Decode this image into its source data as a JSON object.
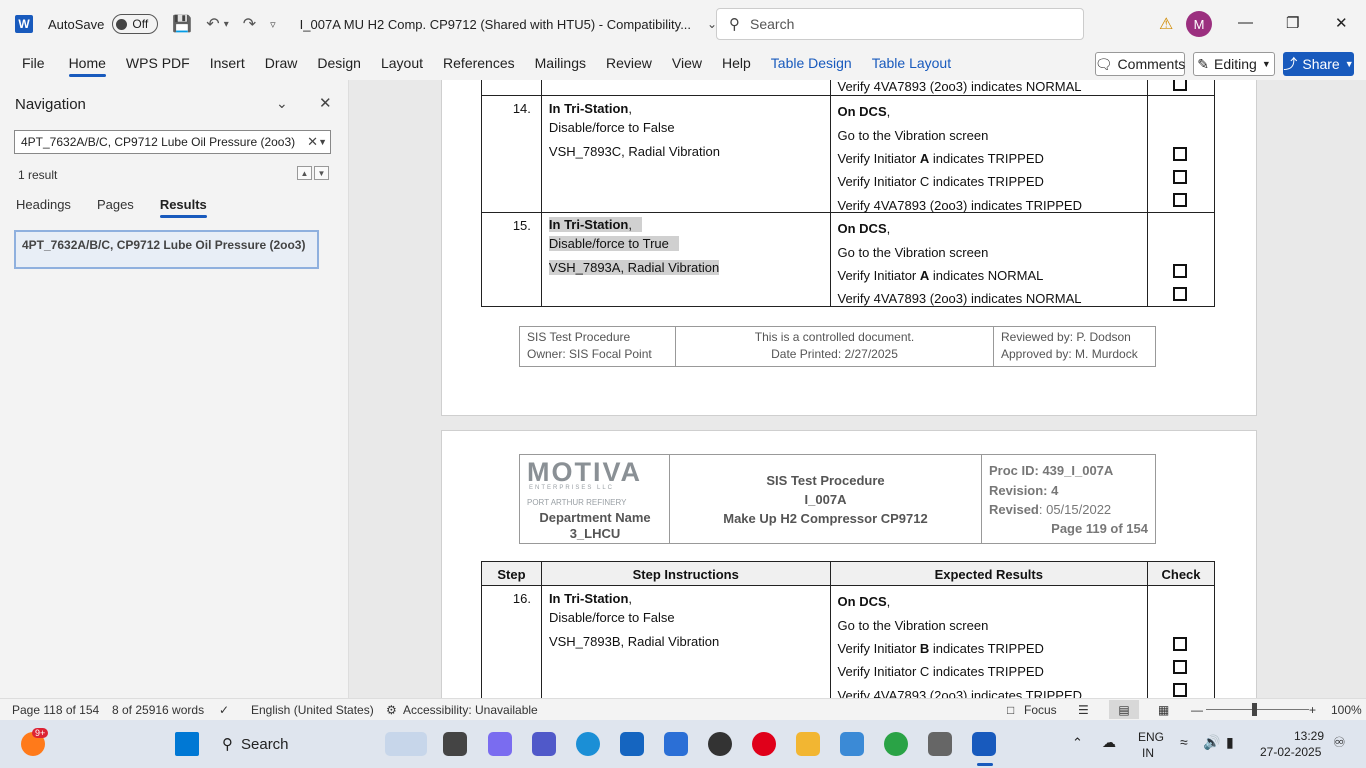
{
  "titlebar": {
    "app_icon": "W",
    "autosave_label": "AutoSave",
    "autosave_state": "Off",
    "doc_title": "I_007A MU H2 Comp. CP9712 (Shared with HTU5)  -  Compatibility...",
    "search_placeholder": "Search",
    "avatar_initial": "M"
  },
  "ribbon": {
    "tabs": [
      "File",
      "Home",
      "WPS PDF",
      "Insert",
      "Draw",
      "Design",
      "Layout",
      "References",
      "Mailings",
      "Review",
      "View",
      "Help",
      "Table Design",
      "Table Layout"
    ],
    "active_tab": "Home",
    "comments_label": "Comments",
    "editing_label": "Editing",
    "share_label": "Share"
  },
  "navigation": {
    "title": "Navigation",
    "search_value": "4PT_7632A/B/C, CP9712 Lube Oil Pressure (2oo3)",
    "result_count": "1 result",
    "tabs": [
      "Headings",
      "Pages",
      "Results"
    ],
    "active_tab": "Results",
    "result_item": "4PT_7632A/B/C, CP9712 Lube Oil Pressure (2oo3)"
  },
  "page1": {
    "top_row_expected": "Verify 4VA7893 (2oo3) indicates NORMAL",
    "rows": [
      {
        "step": "14.",
        "instr1_bold": "In Tri-Station",
        "instr1_rest": ",",
        "instr2": "Disable/force to False",
        "instr3": "VSH_7893C, Radial Vibration",
        "exp1_bold": "On DCS",
        "exp1_rest": ",",
        "exp2": "Go to the Vibration screen",
        "exp3_pre": "Verify Initiator ",
        "exp3_bold": "A",
        "exp3_post": " indicates TRIPPED",
        "exp4": "Verify Initiator C indicates TRIPPED",
        "exp5": "Verify 4VA7893 (2oo3) indicates TRIPPED"
      },
      {
        "step": "15.",
        "instr1_bold": "In Tri-Station",
        "instr1_rest": ",",
        "instr2": "Disable/force to True",
        "instr3": "VSH_7893A, Radial Vibration",
        "exp1_bold": "On DCS",
        "exp1_rest": ",",
        "exp2": "Go to the Vibration screen",
        "exp3_pre": "Verify Initiator ",
        "exp3_bold": "A",
        "exp3_post": " indicates NORMAL",
        "exp4": "Verify 4VA7893 (2oo3) indicates NORMAL"
      }
    ],
    "footer": {
      "left1": "SIS Test Procedure",
      "left2": "Owner: SIS Focal Point",
      "mid1": "This is a controlled document.",
      "mid2": "Date Printed: 2/27/2025",
      "right1": "Reviewed by: P. Dodson",
      "right2": "Approved by: M. Murdock"
    }
  },
  "page2": {
    "header": {
      "logo": "MOTIVA",
      "logo_sub": "ENTERPRISES LLC",
      "refinery": "PORT ARTHUR REFINERY",
      "dept1": "Department Name",
      "dept2": "3_LHCU",
      "title1": "SIS Test Procedure",
      "title2": "I_007A",
      "title3": "Make Up H2 Compressor CP9712",
      "proc_id": "Proc ID: 439_I_007A",
      "revision": "Revision: 4",
      "revised_label": "Revised",
      "revised_value": ": 05/15/2022",
      "page": "Page 119 of 154"
    },
    "columns": [
      "Step",
      "Step Instructions",
      "Expected Results",
      "Check"
    ],
    "row": {
      "step": "16.",
      "instr1_bold": "In Tri-Station",
      "instr1_rest": ",",
      "instr2": "Disable/force to False",
      "instr3": "VSH_7893B, Radial Vibration",
      "exp1_bold": "On DCS",
      "exp1_rest": ",",
      "exp2": "Go to the Vibration screen",
      "exp3_pre": "Verify Initiator ",
      "exp3_bold": "B",
      "exp3_post": " indicates TRIPPED",
      "exp4": "Verify Initiator C indicates TRIPPED",
      "exp5": "Verify 4VA7893 (2oo3) indicates TRIPPED"
    }
  },
  "statusbar": {
    "page": "Page 118 of 154",
    "words": "8 of 25916 words",
    "language": "English (United States)",
    "accessibility": "Accessibility: Unavailable",
    "focus": "Focus",
    "zoom": "100%"
  },
  "taskbar": {
    "search_label": "Search",
    "badge": "9+",
    "lang1": "ENG",
    "lang2": "IN",
    "time": "13:29",
    "date": "27-02-2025"
  },
  "colors": {
    "accent": "#185abd",
    "highlight": "#d0d0d0",
    "avatar": "#9b2f7f"
  }
}
